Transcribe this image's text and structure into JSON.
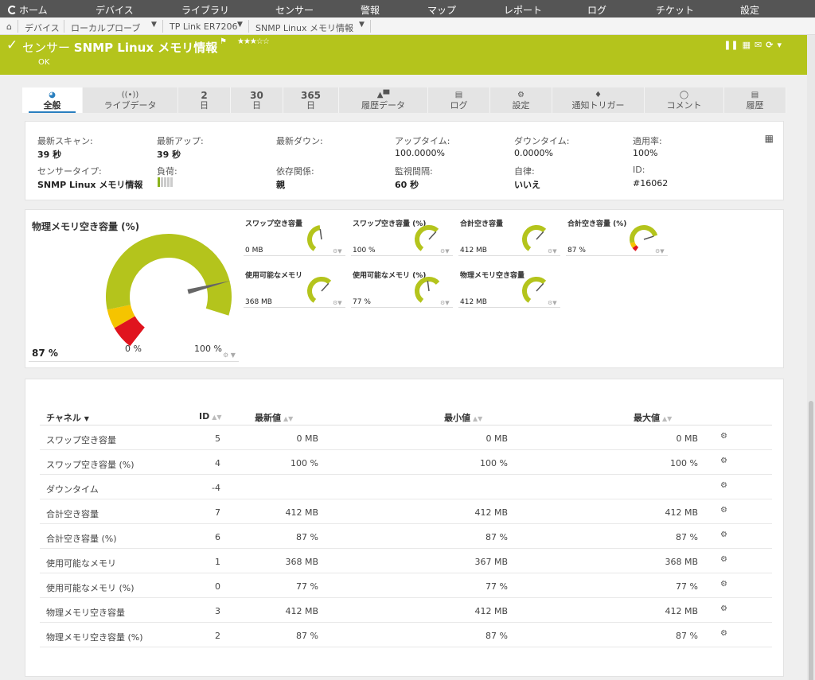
{
  "nav": {
    "home": "ホーム",
    "items": [
      "デバイス",
      "ライブラリ",
      "センサー",
      "警報",
      "マップ",
      "レポート",
      "ログ",
      "チケット",
      "設定"
    ]
  },
  "breadcrumb": [
    "デバイス",
    "ローカルプローブ",
    "TP Link ER7206",
    "SNMP Linux メモリ情報"
  ],
  "header": {
    "prefix": "センサー",
    "name": "SNMP Linux メモリ情報",
    "stars": "★★★☆☆",
    "status": "OK"
  },
  "tabs": [
    {
      "label": "全般",
      "icon": "overview-icon",
      "active": true
    },
    {
      "label": "ライブデータ",
      "icon": "live-data-icon"
    },
    {
      "num": "2",
      "label": "日"
    },
    {
      "num": "30",
      "label": "日"
    },
    {
      "num": "365",
      "label": "日"
    },
    {
      "label": "履歴データ",
      "icon": "chart-icon"
    },
    {
      "label": "ログ",
      "icon": "log-icon"
    },
    {
      "label": "設定",
      "icon": "gear-icon"
    },
    {
      "label": "通知トリガー",
      "icon": "bell-icon"
    },
    {
      "label": "コメント",
      "icon": "comment-icon"
    },
    {
      "label": "履歴",
      "icon": "history-icon"
    }
  ],
  "info": {
    "last_scan_label": "最新スキャン:",
    "last_scan": "39 秒",
    "last_up_label": "最新アップ:",
    "last_up": "39 秒",
    "last_down_label": "最新ダウン:",
    "uptime_label": "アップタイム:",
    "uptime": "100.0000%",
    "downtime_label": "ダウンタイム:",
    "downtime": "0.0000%",
    "coverage_label": "適用率:",
    "coverage": "100%",
    "sensor_type_label": "センサータイプ:",
    "sensor_type": "SNMP Linux メモリ情報",
    "load_label": "負荷:",
    "dependency_label": "依存関係:",
    "dependency": "親",
    "interval_label": "監視間隔:",
    "interval": "60 秒",
    "autonomous_label": "自律:",
    "autonomous": "いいえ",
    "id_label": "ID:",
    "id": "#16062"
  },
  "big_gauge": {
    "title": "物理メモリ空き容量 (%)",
    "value": "87 %",
    "min": "0 %",
    "max": "100 %",
    "percent": 87
  },
  "mini_gauges": [
    {
      "title": "スワップ空き容量",
      "value": "0 MB",
      "fill": 0.55,
      "needle": 0.55,
      "red": false
    },
    {
      "title": "スワップ空き容量 (%)",
      "value": "100 %",
      "fill": 0.75,
      "needle": 0.75,
      "red": false
    },
    {
      "title": "合計空き容量",
      "value": "412 MB",
      "fill": 0.75,
      "needle": 0.75,
      "red": false
    },
    {
      "title": "合計空き容量 (%)",
      "value": "87 %",
      "fill": 0.87,
      "needle": 0.87,
      "red": true
    },
    {
      "title": "使用可能なメモリ",
      "value": "368 MB",
      "fill": 0.75,
      "needle": 0.75,
      "red": false
    },
    {
      "title": "使用可能なメモリ (%)",
      "value": "77 %",
      "fill": 0.77,
      "needle": 0.55,
      "red": false
    },
    {
      "title": "物理メモリ空き容量",
      "value": "412 MB",
      "fill": 0.75,
      "needle": 0.75,
      "red": false
    }
  ],
  "table": {
    "headers": {
      "channel": "チャネル",
      "id": "ID",
      "last": "最新値",
      "min": "最小値",
      "max": "最大値"
    },
    "rows": [
      {
        "channel": "スワップ空き容量",
        "id": "5",
        "last": "0 MB",
        "min": "0 MB",
        "max": "0 MB"
      },
      {
        "channel": "スワップ空き容量 (%)",
        "id": "4",
        "last": "100 %",
        "min": "100 %",
        "max": "100 %"
      },
      {
        "channel": "ダウンタイム",
        "id": "-4",
        "last": "",
        "min": "",
        "max": ""
      },
      {
        "channel": "合計空き容量",
        "id": "7",
        "last": "412 MB",
        "min": "412 MB",
        "max": "412 MB"
      },
      {
        "channel": "合計空き容量 (%)",
        "id": "6",
        "last": "87 %",
        "min": "87 %",
        "max": "87 %"
      },
      {
        "channel": "使用可能なメモリ",
        "id": "1",
        "last": "368 MB",
        "min": "367 MB",
        "max": "368 MB"
      },
      {
        "channel": "使用可能なメモリ (%)",
        "id": "0",
        "last": "77 %",
        "min": "77 %",
        "max": "77 %"
      },
      {
        "channel": "物理メモリ空き容量",
        "id": "3",
        "last": "412 MB",
        "min": "412 MB",
        "max": "412 MB"
      },
      {
        "channel": "物理メモリ空き容量 (%)",
        "id": "2",
        "last": "87 %",
        "min": "87 %",
        "max": "87 %"
      }
    ]
  },
  "colors": {
    "accent": "#b4c41c",
    "gauge_green": "#b4c41c",
    "gauge_yellow": "#f5c400",
    "gauge_red": "#e0141e",
    "nav_bg": "#555555"
  }
}
